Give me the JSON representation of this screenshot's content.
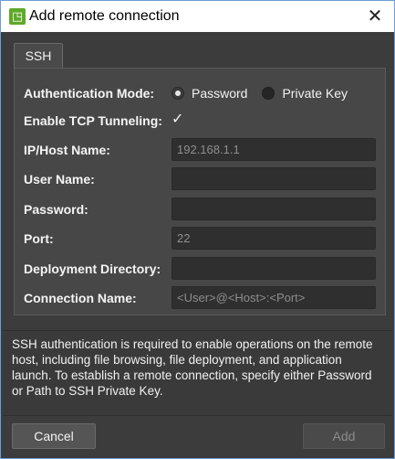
{
  "window": {
    "title": "Add remote connection",
    "close_glyph": "✕"
  },
  "tabs": [
    {
      "label": "SSH"
    }
  ],
  "form": {
    "auth_mode": {
      "label": "Authentication Mode:",
      "options": [
        {
          "label": "Password",
          "selected": true
        },
        {
          "label": "Private Key",
          "selected": false
        }
      ]
    },
    "tcp_tunneling": {
      "label": "Enable TCP Tunneling:",
      "checked": true,
      "check_glyph": "✓"
    },
    "host": {
      "label": "IP/Host Name:",
      "placeholder": "192.168.1.1",
      "value": ""
    },
    "user": {
      "label": "User Name:",
      "placeholder": "",
      "value": ""
    },
    "password": {
      "label": "Password:",
      "placeholder": "",
      "value": ""
    },
    "port": {
      "label": "Port:",
      "placeholder": "22",
      "value": ""
    },
    "deploy_dir": {
      "label": "Deployment Directory:",
      "placeholder": "",
      "value": ""
    },
    "connection_name": {
      "label": "Connection Name:",
      "placeholder": "<User>@<Host>:<Port>",
      "value": ""
    }
  },
  "info": {
    "text": "SSH authentication is required to enable operations on the remote host, including file browsing, file deployment, and application launch. To establish a remote connection, specify either Password or Path to SSH Private Key."
  },
  "buttons": {
    "cancel": "Cancel",
    "add": "Add"
  },
  "colors": {
    "background": "#3c3c3c",
    "panel": "#474747",
    "field": "#2f2f2f",
    "text": "#f4f4f4",
    "disabled_text": "#8a8a8a",
    "titlebar": "#ffffff",
    "window_border": "#6b9fd6"
  }
}
